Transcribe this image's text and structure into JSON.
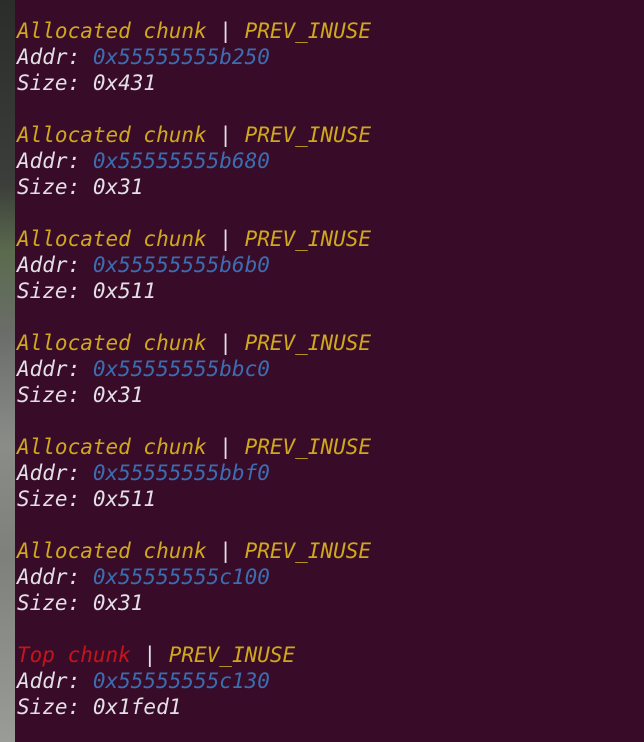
{
  "chunks": [
    {
      "kind": "Allocated chunk",
      "type": "alloc",
      "sep": " | ",
      "flag": "PREV_INUSE",
      "addr_label": "Addr: ",
      "addr": "0x55555555b250",
      "size_label": "Size: ",
      "size": "0x431"
    },
    {
      "kind": "Allocated chunk",
      "type": "alloc",
      "sep": " | ",
      "flag": "PREV_INUSE",
      "addr_label": "Addr: ",
      "addr": "0x55555555b680",
      "size_label": "Size: ",
      "size": "0x31"
    },
    {
      "kind": "Allocated chunk",
      "type": "alloc",
      "sep": " | ",
      "flag": "PREV_INUSE",
      "addr_label": "Addr: ",
      "addr": "0x55555555b6b0",
      "size_label": "Size: ",
      "size": "0x511"
    },
    {
      "kind": "Allocated chunk",
      "type": "alloc",
      "sep": " | ",
      "flag": "PREV_INUSE",
      "addr_label": "Addr: ",
      "addr": "0x55555555bbc0",
      "size_label": "Size: ",
      "size": "0x31"
    },
    {
      "kind": "Allocated chunk",
      "type": "alloc",
      "sep": " | ",
      "flag": "PREV_INUSE",
      "addr_label": "Addr: ",
      "addr": "0x55555555bbf0",
      "size_label": "Size: ",
      "size": "0x511"
    },
    {
      "kind": "Allocated chunk",
      "type": "alloc",
      "sep": " | ",
      "flag": "PREV_INUSE",
      "addr_label": "Addr: ",
      "addr": "0x55555555c100",
      "size_label": "Size: ",
      "size": "0x31"
    },
    {
      "kind": "Top chunk",
      "type": "top",
      "sep": " | ",
      "flag": "PREV_INUSE",
      "addr_label": "Addr: ",
      "addr": "0x55555555c130",
      "size_label": "Size: ",
      "size": "0x1fed1"
    }
  ],
  "colors": {
    "background": "#380c29",
    "allocated_kind": "#cfa81d",
    "top_kind": "#c5141a",
    "flag": "#cfa81d",
    "address": "#3d6db1",
    "text": "#e3dfe6"
  }
}
